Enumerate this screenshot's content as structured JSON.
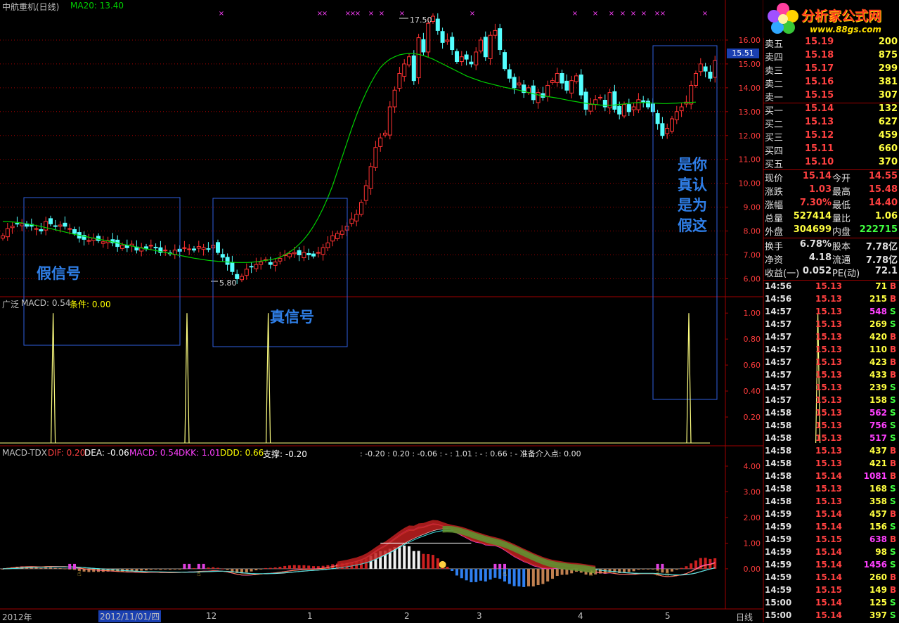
{
  "header": {
    "main_title": "中航重机(日线)",
    "ma_label": "MA20: 13.40",
    "indicator_title": "广泛",
    "indicator_macd": "MACD: 0.54",
    "indicator_cond": "条件: 0.00",
    "macd_title": "MACD-TDX",
    "macd_dif": "DIF: 0.20",
    "macd_dea": "DEA: -0.06",
    "macd_macd": "MACD: 0.54",
    "macd_dkk": "DKK: 1.01",
    "macd_ddd": "DDD: 0.66",
    "macd_support": "支撑: -0.20",
    "macd_extra": ": -0.20 : 0.20 : -0.06 : - : 1.01 : - : 0.66 : -  准备介入点: 0.00"
  },
  "logo": {
    "title": "分析家公式网",
    "url": "www.88gs.com"
  },
  "annotations": {
    "fake_signal": "假信号",
    "true_signal": "真信号",
    "question": [
      "是你",
      "真认",
      "是为",
      "假这"
    ]
  },
  "price_axis_marker": "15.51",
  "bottom_axis": {
    "labels": [
      "2012年",
      "2012/11/01/四",
      "12",
      "1",
      "2",
      "3",
      "4",
      "5"
    ],
    "period": "日线"
  },
  "chart_data": [
    {
      "type": "candlestick",
      "title": "中航重机(日线)",
      "yticks": [
        "16.00",
        "15.00",
        "14.00",
        "13.00",
        "12.00",
        "11.00",
        "10.00",
        "9.00",
        "8.00",
        "7.00",
        "6.00"
      ],
      "ylim": [
        5.6,
        16.5
      ],
      "annotations": [
        {
          "label": "17.50"
        },
        {
          "label": "5.80"
        }
      ],
      "close": [
        7.8,
        8.1,
        8.2,
        8.3,
        8.3,
        8.2,
        8.2,
        8.1,
        8.0,
        8.4,
        8.3,
        8.2,
        8.25,
        8.2,
        8.1,
        7.9,
        7.7,
        7.65,
        7.6,
        7.7,
        7.6,
        7.55,
        7.6,
        7.5,
        7.35,
        7.4,
        7.3,
        7.45,
        7.2,
        7.3,
        7.25,
        7.4,
        7.3,
        7.1,
        7.2,
        7.05,
        7.2,
        7.15,
        7.3,
        7.25,
        7.2,
        7.35,
        7.3,
        7.25,
        7.4,
        7.1,
        6.9,
        6.6,
        6.3,
        6.0,
        6.1,
        6.4,
        6.5,
        6.6,
        6.7,
        6.8,
        6.6,
        6.7,
        6.85,
        7.0,
        7.05,
        7.1,
        7.0,
        7.1,
        7.0,
        6.95,
        7.1,
        7.3,
        7.5,
        7.8,
        7.9,
        8.0,
        8.2,
        8.5,
        8.7,
        9.2,
        9.9,
        10.7,
        11.5,
        11.9,
        12.1,
        13.2,
        13.9,
        14.6,
        15.0,
        15.3,
        14.3,
        16.1,
        15.5,
        16.7,
        17.0,
        16.4,
        15.9,
        16.0,
        15.6,
        15.1,
        15.3,
        15.2,
        15.0,
        15.5,
        16.0,
        15.3,
        16.2,
        16.4,
        15.6,
        14.8,
        14.4,
        14.0,
        14.2,
        13.8,
        14.0,
        13.5,
        13.8,
        13.6,
        14.1,
        14.3,
        14.6,
        14.2,
        13.9,
        14.3,
        14.5,
        13.7,
        13.1,
        13.3,
        13.5,
        13.6,
        13.2,
        13.8,
        13.1,
        12.9,
        13.3,
        13.0,
        13.2,
        13.5,
        13.4,
        13.2,
        13.0,
        12.5,
        12.0,
        12.3,
        12.7,
        13.0,
        13.2,
        13.4,
        14.1,
        14.6,
        15.0,
        14.7,
        14.4,
        15.14
      ],
      "ma20": [
        8.4,
        8.39,
        8.38,
        8.36,
        8.34,
        8.3,
        8.27,
        8.23,
        8.19,
        8.14,
        8.1,
        8.05,
        8.01,
        7.96,
        7.91,
        7.86,
        7.82,
        7.78,
        7.74,
        7.7,
        7.66,
        7.62,
        7.58,
        7.54,
        7.5,
        7.45,
        7.41,
        7.37,
        7.33,
        7.29,
        7.25,
        7.22,
        7.18,
        7.14,
        7.1,
        7.06,
        7.02,
        6.98,
        6.94,
        6.9,
        6.86,
        6.83,
        6.8,
        6.77,
        6.75,
        6.73,
        6.72,
        6.7,
        6.69,
        6.68,
        6.68,
        6.68,
        6.69,
        6.71,
        6.74,
        6.77,
        6.8,
        6.84,
        6.9,
        7.0,
        7.12,
        7.26,
        7.44,
        7.65,
        7.9,
        8.2,
        8.55,
        8.95,
        9.4,
        9.9,
        10.5,
        11.1,
        11.7,
        12.3,
        12.85,
        13.35,
        13.8,
        14.2,
        14.55,
        14.85,
        15.05,
        15.2,
        15.3,
        15.38,
        15.42,
        15.44,
        15.43,
        15.4,
        15.35,
        15.28,
        15.2,
        15.1,
        15.0,
        14.9,
        14.8,
        14.7,
        14.6,
        14.5,
        14.42,
        14.35,
        14.28,
        14.22,
        14.17,
        14.12,
        14.07,
        14.02,
        13.98,
        13.94,
        13.9,
        13.85,
        13.8,
        13.75,
        13.7,
        13.66,
        13.63,
        13.6,
        13.57,
        13.53,
        13.49,
        13.45,
        13.42,
        13.38,
        13.35,
        13.32,
        13.3,
        13.28,
        13.27,
        13.27,
        13.28,
        13.3,
        13.32,
        13.35,
        13.37,
        13.38,
        13.38,
        13.37,
        13.36,
        13.35,
        13.34,
        13.34,
        13.35,
        13.36,
        13.37,
        13.38,
        13.39,
        13.4
      ]
    },
    {
      "type": "line",
      "title": "广泛",
      "yticks": [
        "1.00",
        "0.80",
        "0.60",
        "0.40",
        "0.20"
      ],
      "ylim": [
        0,
        1.05
      ],
      "spikes_at": [
        12,
        40,
        57,
        145,
        172
      ]
    },
    {
      "type": "line",
      "title": "MACD-TDX",
      "yticks": [
        "4.00",
        "3.00",
        "2.00",
        "1.00",
        "0.00"
      ],
      "ylim": [
        -1.4,
        4.3
      ],
      "series": [
        {
          "name": "DIF",
          "color": "#ff00ff"
        },
        {
          "name": "DEA",
          "color": "#ffffff"
        },
        {
          "name": "MACD",
          "color": "#ff0000"
        },
        {
          "name": "DKK",
          "color": "#ff00ff"
        },
        {
          "name": "DDD",
          "color": "#ffff00"
        }
      ]
    }
  ],
  "quote": {
    "code_price": "15.51",
    "asks": [
      {
        "label": "卖五",
        "price": "15.19",
        "vol": "200"
      },
      {
        "label": "卖四",
        "price": "15.18",
        "vol": "875"
      },
      {
        "label": "卖三",
        "price": "15.17",
        "vol": "299"
      },
      {
        "label": "卖二",
        "price": "15.16",
        "vol": "381"
      },
      {
        "label": "卖一",
        "price": "15.15",
        "vol": "307"
      }
    ],
    "bids": [
      {
        "label": "买一",
        "price": "15.14",
        "vol": "132"
      },
      {
        "label": "买二",
        "price": "15.13",
        "vol": "627"
      },
      {
        "label": "买三",
        "price": "15.12",
        "vol": "459"
      },
      {
        "label": "买四",
        "price": "15.11",
        "vol": "660"
      },
      {
        "label": "买五",
        "price": "15.10",
        "vol": "370"
      }
    ],
    "stats": [
      {
        "l1": "现价",
        "v1": "15.14",
        "l2": "今开",
        "v2": "14.55"
      },
      {
        "l1": "涨跌",
        "v1": "1.03",
        "l2": "最高",
        "v2": "15.48"
      },
      {
        "l1": "涨幅",
        "v1": "7.30%",
        "l2": "最低",
        "v2": "14.40"
      },
      {
        "l1": "总量",
        "v1": "527414",
        "l2": "量比",
        "v2": "1.06"
      },
      {
        "l1": "外盘",
        "v1": "304699",
        "l2": "内盘",
        "v2": "222715"
      }
    ],
    "stats2": [
      {
        "l1": "换手",
        "v1": "6.78%",
        "l2": "股本",
        "v2": "7.78亿"
      },
      {
        "l1": "净资",
        "v1": "4.18",
        "l2": "流通",
        "v2": "7.78亿"
      },
      {
        "l1": "收益(一)",
        "v1": "0.052",
        "l2": "PE(动)",
        "v2": "72.1"
      }
    ],
    "ticks": [
      {
        "time": "14:56",
        "price": "15.13",
        "vol": "71",
        "side": "B"
      },
      {
        "time": "14:56",
        "price": "15.13",
        "vol": "215",
        "side": "B"
      },
      {
        "time": "14:57",
        "price": "15.13",
        "vol": "548",
        "side": "S"
      },
      {
        "time": "14:57",
        "price": "15.13",
        "vol": "269",
        "side": "S"
      },
      {
        "time": "14:57",
        "price": "15.13",
        "vol": "420",
        "side": "B"
      },
      {
        "time": "14:57",
        "price": "15.13",
        "vol": "110",
        "side": "B"
      },
      {
        "time": "14:57",
        "price": "15.13",
        "vol": "423",
        "side": "B"
      },
      {
        "time": "14:57",
        "price": "15.13",
        "vol": "433",
        "side": "B"
      },
      {
        "time": "14:57",
        "price": "15.13",
        "vol": "239",
        "side": "S"
      },
      {
        "time": "14:57",
        "price": "15.13",
        "vol": "158",
        "side": "S"
      },
      {
        "time": "14:58",
        "price": "15.13",
        "vol": "562",
        "side": "S"
      },
      {
        "time": "14:58",
        "price": "15.13",
        "vol": "756",
        "side": "S"
      },
      {
        "time": "14:58",
        "price": "15.13",
        "vol": "517",
        "side": "S"
      },
      {
        "time": "14:58",
        "price": "15.13",
        "vol": "437",
        "side": "B"
      },
      {
        "time": "14:58",
        "price": "15.13",
        "vol": "421",
        "side": "B"
      },
      {
        "time": "14:58",
        "price": "15.14",
        "vol": "1081",
        "side": "B"
      },
      {
        "time": "14:58",
        "price": "15.13",
        "vol": "168",
        "side": "S"
      },
      {
        "time": "14:58",
        "price": "15.13",
        "vol": "358",
        "side": "S"
      },
      {
        "time": "14:59",
        "price": "15.14",
        "vol": "457",
        "side": "B"
      },
      {
        "time": "14:59",
        "price": "15.14",
        "vol": "156",
        "side": "S"
      },
      {
        "time": "14:59",
        "price": "15.15",
        "vol": "638",
        "side": "B"
      },
      {
        "time": "14:59",
        "price": "15.14",
        "vol": "98",
        "side": "S"
      },
      {
        "time": "14:59",
        "price": "15.14",
        "vol": "1456",
        "side": "S"
      },
      {
        "time": "14:59",
        "price": "15.14",
        "vol": "260",
        "side": "B"
      },
      {
        "time": "14:59",
        "price": "15.15",
        "vol": "149",
        "side": "B"
      },
      {
        "time": "15:00",
        "price": "15.14",
        "vol": "125",
        "side": "S"
      },
      {
        "time": "15:00",
        "price": "15.14",
        "vol": "397",
        "side": "S"
      }
    ]
  },
  "colors": {
    "up": "#ff3232",
    "down": "#54ffff",
    "ma20": "#00d000",
    "grid_red": "#a00000",
    "annotation_box": "#3060e0",
    "annotation_text": "#2f7fe8"
  }
}
